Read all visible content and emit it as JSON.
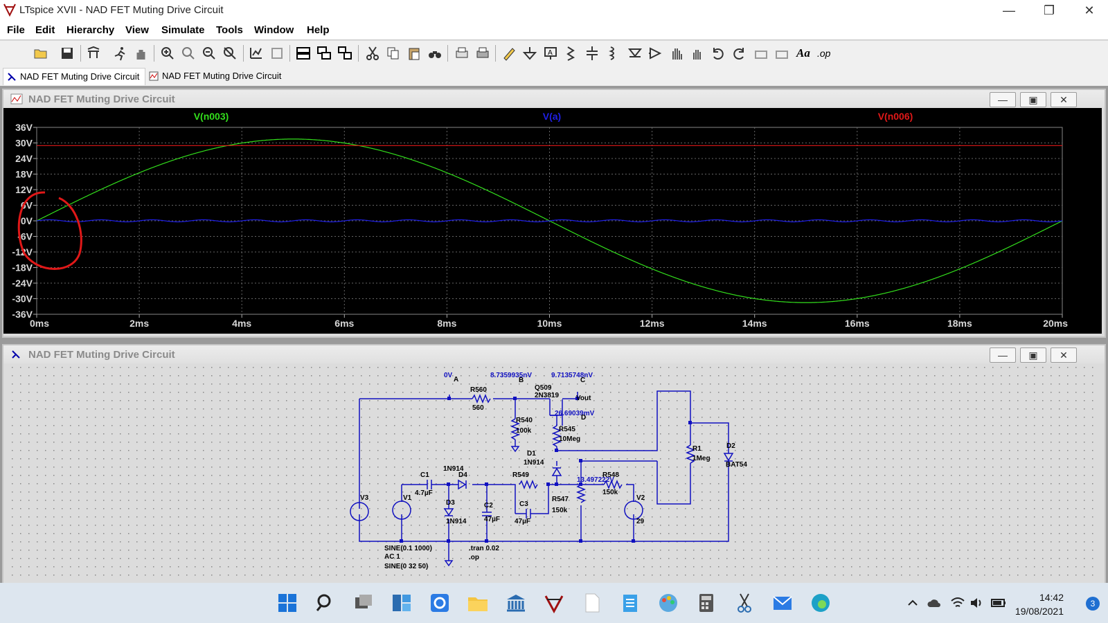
{
  "window": {
    "title": "LTspice XVII - NAD FET Muting Drive Circuit",
    "controls": [
      "—",
      "❐",
      "✕"
    ]
  },
  "menu": [
    "File",
    "Edit",
    "Hierarchy",
    "View",
    "Simulate",
    "Tools",
    "Window",
    "Help"
  ],
  "toolbar": {
    "icons": [
      "open-icon",
      "save-icon",
      "control-panel-icon",
      "run-icon",
      "pan-icon",
      "zoom-in-icon",
      "zoom-area-icon",
      "zoom-out-icon",
      "zoom-cancel-icon",
      "autorange-icon",
      "fit-icon",
      "tile-horizontal-icon",
      "tile-vertical-icon",
      "cascade-icon",
      "cut-icon",
      "copy-icon",
      "paste-icon",
      "find-icon",
      "print-preview-icon",
      "print-icon",
      "draw-wire-icon",
      "ground-icon",
      "label-net-icon",
      "resistor-icon",
      "capacitor-icon",
      "inductor-icon",
      "diode-icon",
      "component-icon",
      "move-icon",
      "drag-icon",
      "undo-icon",
      "redo-icon",
      "rotate-icon",
      "mirror-icon",
      "text-icon",
      "spice-directive-icon"
    ],
    "text_label": "Aa",
    "op_label": ".op"
  },
  "tabs": [
    {
      "label": "NAD FET Muting Drive Circuit",
      "kind": "schematic"
    },
    {
      "label": "NAD FET Muting Drive Circuit",
      "kind": "waveform"
    }
  ],
  "waveform": {
    "title": "NAD FET Muting Drive Circuit",
    "traces": [
      {
        "name": "V(n003)",
        "color": "#33e01c"
      },
      {
        "name": "V(a)",
        "color": "#1f1fe6"
      },
      {
        "name": "V(n006)",
        "color": "#e01818"
      }
    ]
  },
  "chart_data": {
    "type": "line",
    "xlabel": "",
    "ylabel": "",
    "x_ticks": [
      "0ms",
      "2ms",
      "4ms",
      "6ms",
      "8ms",
      "10ms",
      "12ms",
      "14ms",
      "16ms",
      "18ms",
      "20ms"
    ],
    "y_ticks": [
      "36V",
      "30V",
      "24V",
      "18V",
      "12V",
      "6V",
      "0V",
      "-6V",
      "-12V",
      "-18V",
      "-24V",
      "-30V",
      "-36V"
    ],
    "xlim": [
      0,
      20
    ],
    "ylim": [
      -36,
      36
    ],
    "grid": true,
    "series": [
      {
        "name": "V(n003)",
        "kind": "sine",
        "amplitude": 31.5,
        "period_ms": 20,
        "offset": 0
      },
      {
        "name": "V(a)",
        "kind": "sine",
        "amplitude": 0.4,
        "period_ms": 1,
        "offset": 0
      },
      {
        "name": "V(n006)",
        "kind": "constant",
        "value": 29
      }
    ]
  },
  "schematic": {
    "title": "NAD FET Muting Drive Circuit",
    "labels": {
      "node_a_voltage": "0V",
      "node_a": "A",
      "node_b_voltage": "8.7359935nV",
      "node_b": "B",
      "node_c_voltage": "9.7135748nV",
      "node_c": "C",
      "node_d_voltage": "26.69039mV",
      "node_d": "D",
      "vout": "Vout",
      "q509": "Q509",
      "q509_model": "2N3819",
      "r560": "R560",
      "r560_val": "560",
      "r540": "R540",
      "r540_val": "100k",
      "r545": "R545",
      "r545_val": "10Meg",
      "d1": "D1",
      "d1_model": "1N914",
      "r1": "R1",
      "r1_val": "1Meg",
      "d2": "D2",
      "d2_model": "BAT54",
      "d4_model": "1N914",
      "d4": "D4",
      "c1": "C1",
      "c1_val": "4.7µF",
      "r549": "R549",
      "r548": "R548",
      "r548_val": "150k",
      "node_e_voltage": "13.497222V",
      "r547": "R547",
      "r547_val": "150k",
      "v3": "V3",
      "v1": "V1",
      "v2": "V2",
      "v2_val": "29",
      "d3": "D3",
      "d3_model": "1N914",
      "c2": "C2",
      "c2_val": "47µF",
      "c3": "C3",
      "c3_val": "47µF",
      "v1_spec": "SINE(0.1 1000)",
      "v1_ac": "AC 1",
      "v3_spec": "SINE(0 32 50)",
      "tran": ".tran 0.02",
      "op": ".op"
    }
  },
  "taskbar": {
    "apps": [
      "start-icon",
      "search-icon",
      "task-view-icon",
      "widgets-icon",
      "sync-icon",
      "file-explorer-icon",
      "bank-icon",
      "ltspice-icon",
      "file-icon",
      "notepad-icon",
      "paint-icon",
      "calculator-icon",
      "snipping-icon",
      "mail-icon",
      "edge-icon"
    ],
    "time": "14:42",
    "date": "19/08/2021",
    "notifications": "3"
  }
}
